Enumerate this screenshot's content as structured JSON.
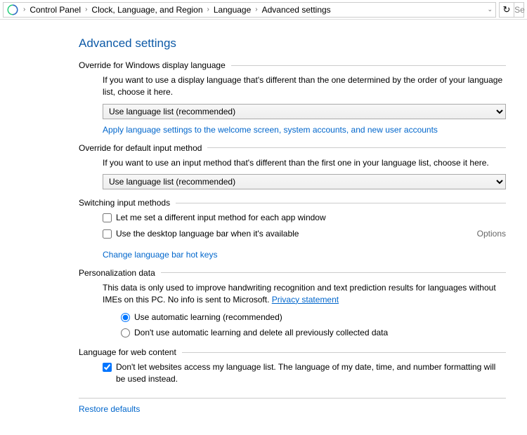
{
  "breadcrumb": {
    "items": [
      "Control Panel",
      "Clock, Language, and Region",
      "Language",
      "Advanced settings"
    ]
  },
  "search_placeholder": "Se",
  "page_title": "Advanced settings",
  "section1": {
    "title": "Override for Windows display language",
    "desc": "If you want to use a display language that's different than the one determined by the order of your language list, choose it here.",
    "combo": "Use language list (recommended)",
    "link": "Apply language settings to the welcome screen, system accounts, and new user accounts"
  },
  "section2": {
    "title": "Override for default input method",
    "desc": "If you want to use an input method that's different than the first one in your language list, choose it here.",
    "combo": "Use language list (recommended)"
  },
  "section3": {
    "title": "Switching input methods",
    "check1": "Let me set a different input method for each app window",
    "check2": "Use the desktop language bar when it's available",
    "options": "Options",
    "link": "Change language bar hot keys"
  },
  "section4": {
    "title": "Personalization data",
    "desc": "This data is only used to improve handwriting recognition and text prediction results for languages without IMEs on this PC. No info is sent to Microsoft. ",
    "privacy": "Privacy statement",
    "radio1": "Use automatic learning (recommended)",
    "radio2": "Don't use automatic learning and delete all previously collected data"
  },
  "section5": {
    "title": "Language for web content",
    "check1": "Don't let websites access my language list. The language of my date, time, and number formatting will be used instead."
  },
  "restore": "Restore defaults"
}
